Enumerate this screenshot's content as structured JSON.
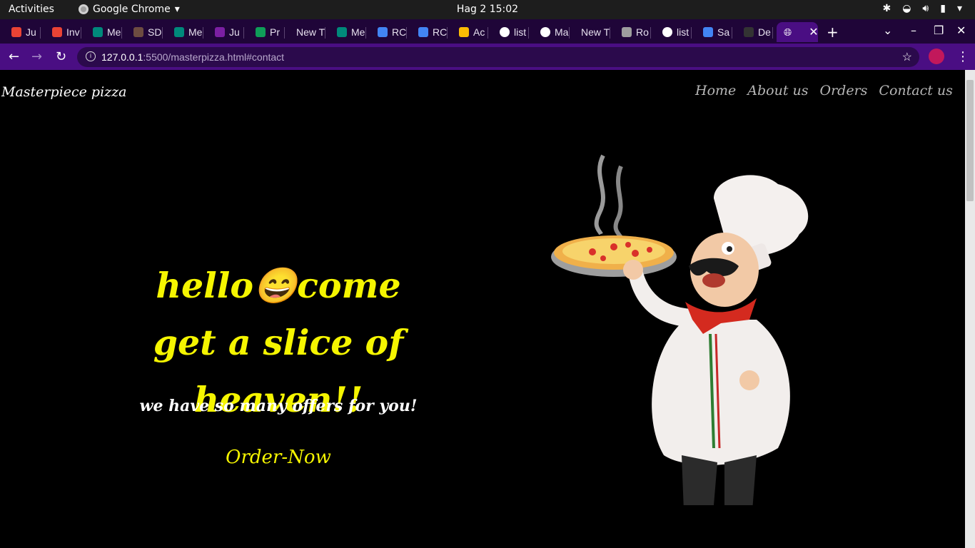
{
  "system": {
    "activities": "Activities",
    "app_name": "Google Chrome",
    "clock": "Hag 2  15:02"
  },
  "tabs": [
    {
      "label": "Ju",
      "favicon": "gmail-icon",
      "color": "#ea4335"
    },
    {
      "label": "Inv",
      "favicon": "gmail-icon",
      "color": "#ea4335"
    },
    {
      "label": "Me",
      "favicon": "meet-icon",
      "color": "#00897b"
    },
    {
      "label": "SD",
      "favicon": "sparkle-icon",
      "color": "#6d4c41"
    },
    {
      "label": "Me",
      "favicon": "meet-icon",
      "color": "#00897b"
    },
    {
      "label": "Ju",
      "favicon": "forms-icon",
      "color": "#7b1fa2"
    },
    {
      "label": "Pr",
      "favicon": "sheets-icon",
      "color": "#0f9d58"
    },
    {
      "label": "New T",
      "favicon": "",
      "color": ""
    },
    {
      "label": "Me",
      "favicon": "meet-icon",
      "color": "#00897b"
    },
    {
      "label": "RC",
      "favicon": "docs-icon",
      "color": "#4285f4"
    },
    {
      "label": "RC",
      "favicon": "docs-icon",
      "color": "#4285f4"
    },
    {
      "label": "Ac",
      "favicon": "drive-icon",
      "color": "#fbbc04"
    },
    {
      "label": "list",
      "favicon": "globe-icon",
      "color": "#ffffff"
    },
    {
      "label": "Ma",
      "favicon": "globe-icon",
      "color": "#ffffff"
    },
    {
      "label": "New T",
      "favicon": "",
      "color": ""
    },
    {
      "label": "Ro",
      "favicon": "wordpress-icon",
      "color": "#9e9e9e"
    },
    {
      "label": "list",
      "favicon": "globe-icon",
      "color": "#ffffff"
    },
    {
      "label": "Sa",
      "favicon": "docs-icon",
      "color": "#4285f4"
    },
    {
      "label": "De",
      "favicon": "github-icon",
      "color": "#333333"
    }
  ],
  "active_tab": {
    "label": "",
    "favicon": "globe-icon"
  },
  "address": {
    "host": "127.0.0.1",
    "path": ":5500/masterpizza.html#contact"
  },
  "page": {
    "brand": "Masterpiece pizza",
    "nav": [
      "Home",
      "About us",
      "Orders",
      "Contact us"
    ],
    "hero_title": "hello😄come get a slice of heaven!!",
    "hero_subtitle": "we have so many offers for you!",
    "cta": "Order-Now"
  },
  "colors": {
    "accent_yellow": "#f5f500",
    "browser_frame": "#4a0e83",
    "tabstrip": "#1f0538"
  }
}
